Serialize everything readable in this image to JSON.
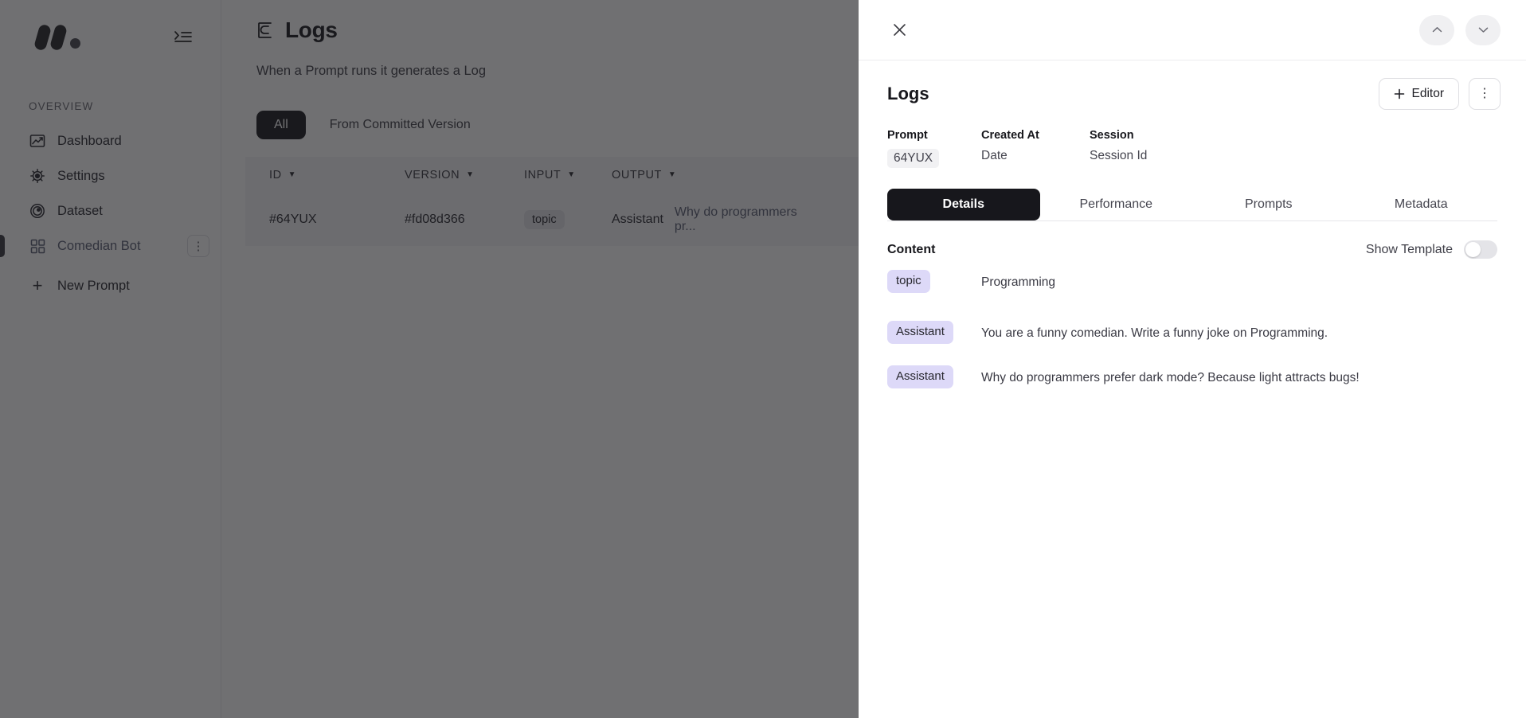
{
  "app": {
    "sidebar": {
      "logo_name": "brand-logo",
      "collapse_icon": "collapse-sidebar-icon",
      "section_label": "OVERVIEW",
      "items": [
        {
          "label": "Dashboard",
          "icon": "chart-line-icon"
        },
        {
          "label": "Settings",
          "icon": "gear-icon"
        },
        {
          "label": "Dataset",
          "icon": "dataset-rings-icon"
        },
        {
          "label": "Comedian Bot",
          "icon": "grid-squares-icon",
          "kebab": "⋮",
          "active": true
        },
        {
          "label": "New Prompt",
          "icon": "plus-icon"
        }
      ]
    },
    "page": {
      "title": "Logs",
      "title_icon": "logs-icon",
      "subtitle": "When a Prompt runs it generates a Log",
      "filters": [
        {
          "label": "All",
          "active": true
        },
        {
          "label": "From Committed Version",
          "active": false
        }
      ],
      "table": {
        "columns": [
          "ID",
          "VERSION",
          "INPUT",
          "OUTPUT"
        ],
        "sort_caret": "▼",
        "rows": [
          {
            "id": "#64YUX",
            "version": "#fd08d366",
            "input_tag": "topic",
            "output_role": "Assistant",
            "output_text": "Why do programmers pr..."
          }
        ]
      }
    }
  },
  "panel": {
    "close_icon": "close-icon",
    "prev_icon": "▲",
    "next_icon": "▼",
    "title": "Logs",
    "editor_button": "Editor",
    "editor_plus": "+",
    "more_icon": "⋮",
    "meta": [
      {
        "label": "Prompt",
        "value": "64YUX",
        "style": "code"
      },
      {
        "label": "Created At",
        "value": "Date",
        "style": "plain"
      },
      {
        "label": "Session",
        "value": "Session Id",
        "style": "plain"
      }
    ],
    "tabs": [
      {
        "label": "Details",
        "active": true
      },
      {
        "label": "Performance",
        "active": false
      },
      {
        "label": "Prompts",
        "active": false
      },
      {
        "label": "Metadata",
        "active": false
      }
    ],
    "content": {
      "heading": "Content",
      "toggle_label": "Show Template",
      "toggle_on": false,
      "rows": [
        {
          "role": "topic",
          "text": "Programming"
        },
        {
          "role": "Assistant",
          "text": "You are a funny comedian. Write a funny joke on Programming."
        },
        {
          "role": "Assistant",
          "text": "Why do programmers prefer dark mode? Because light attracts bugs!"
        }
      ]
    }
  },
  "colors": {
    "accent_dark": "#17171c",
    "pill_lavender": "#ddd9f8",
    "scrim": "rgba(24,24,28,0.62)"
  }
}
